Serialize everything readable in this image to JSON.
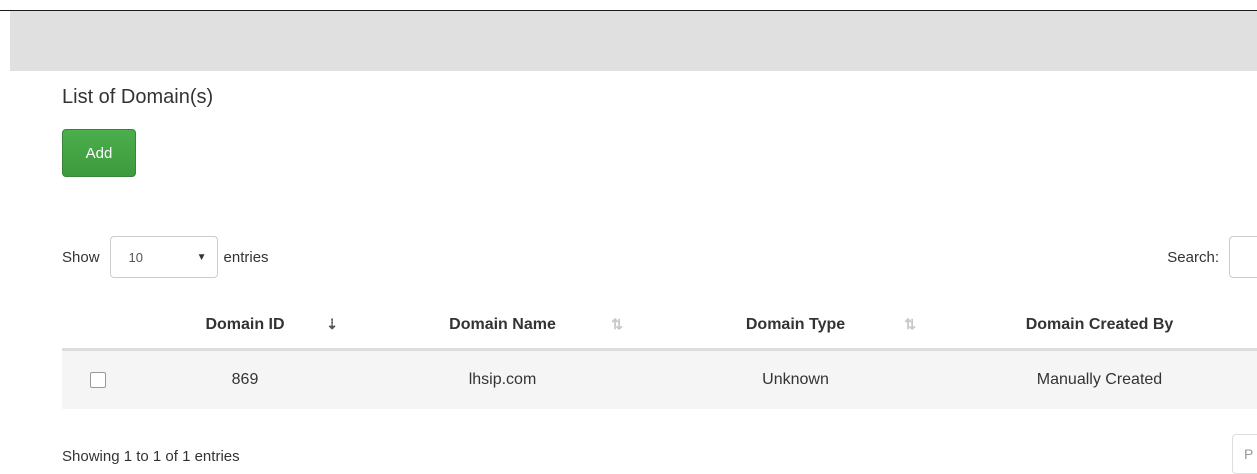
{
  "page": {
    "title": "List of Domain(s)"
  },
  "toolbar": {
    "add_label": "Add"
  },
  "length": {
    "show_label": "Show",
    "selected": "10",
    "entries_label": "entries"
  },
  "search": {
    "label": "Search:",
    "value": ""
  },
  "table": {
    "headers": [
      "Domain ID",
      "Domain Name",
      "Domain Type",
      "Domain Created By"
    ],
    "rows": [
      {
        "checked": false,
        "id": "869",
        "name": "lhsip.com",
        "type": "Unknown",
        "created_by": "Manually Created"
      }
    ]
  },
  "footer": {
    "info": "Showing 1 to 1 of 1 entries",
    "pager_first_char": "P"
  },
  "colors": {
    "add_button": "#45a545",
    "header_band": "#e0e0e0",
    "row_bg": "#f5f5f5"
  }
}
